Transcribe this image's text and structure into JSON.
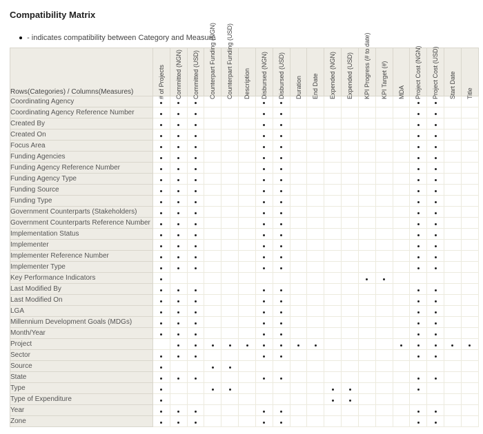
{
  "page_title": "Compatibility Matrix",
  "legend_text": "- indicates compatibility between Category and Measure",
  "corner_label": "Rows(Categories) / Columns(Measures)",
  "columns": [
    "# of Projects",
    "Committed (NGN)",
    "Committed (USD)",
    "Counterpart Funding (NGN)",
    "Counterpart Funding (USD)",
    "Description",
    "Disbursed (NGN)",
    "Disbursed (USD)",
    "Duration",
    "End Date",
    "Expended (NGN)",
    "Expended (USD)",
    "KPI Progress (# to date)",
    "KPI Target (#)",
    "MDA",
    "Project Cost (NGN)",
    "Project Cost (USD)",
    "Start Date",
    "Title"
  ],
  "rows": [
    "Coordinating Agency",
    "Coordinating Agency Reference Number",
    "Created By",
    "Created On",
    "Focus Area",
    "Funding Agencies",
    "Funding Agency Reference Number",
    "Funding Agency Type",
    "Funding Source",
    "Funding Type",
    "Government Counterparts (Stakeholders)",
    "Government Counterparts Reference Number",
    "Implementation Status",
    "Implementer",
    "Implementer Reference Number",
    "Implementer Type",
    "Key Performance Indicators",
    "Last Modified By",
    "Last Modified On",
    "LGA",
    "Millennium Development Goals (MDGs)",
    "Month/Year",
    "Project",
    "Sector",
    "Source",
    "State",
    "Type",
    "Type of Expenditure",
    "Year",
    "Zone"
  ],
  "matrix_comment": "1 = dot present, 0 = empty. Columns order matches 'columns' array.",
  "matrix": [
    [
      1,
      1,
      1,
      0,
      0,
      0,
      1,
      1,
      0,
      0,
      0,
      0,
      0,
      0,
      0,
      1,
      1,
      0,
      0
    ],
    [
      1,
      1,
      1,
      0,
      0,
      0,
      1,
      1,
      0,
      0,
      0,
      0,
      0,
      0,
      0,
      1,
      1,
      0,
      0
    ],
    [
      1,
      1,
      1,
      0,
      0,
      0,
      1,
      1,
      0,
      0,
      0,
      0,
      0,
      0,
      0,
      1,
      1,
      0,
      0
    ],
    [
      1,
      1,
      1,
      0,
      0,
      0,
      1,
      1,
      0,
      0,
      0,
      0,
      0,
      0,
      0,
      1,
      1,
      0,
      0
    ],
    [
      1,
      1,
      1,
      0,
      0,
      0,
      1,
      1,
      0,
      0,
      0,
      0,
      0,
      0,
      0,
      1,
      1,
      0,
      0
    ],
    [
      1,
      1,
      1,
      0,
      0,
      0,
      1,
      1,
      0,
      0,
      0,
      0,
      0,
      0,
      0,
      1,
      1,
      0,
      0
    ],
    [
      1,
      1,
      1,
      0,
      0,
      0,
      1,
      1,
      0,
      0,
      0,
      0,
      0,
      0,
      0,
      1,
      1,
      0,
      0
    ],
    [
      1,
      1,
      1,
      0,
      0,
      0,
      1,
      1,
      0,
      0,
      0,
      0,
      0,
      0,
      0,
      1,
      1,
      0,
      0
    ],
    [
      1,
      1,
      1,
      0,
      0,
      0,
      1,
      1,
      0,
      0,
      0,
      0,
      0,
      0,
      0,
      1,
      1,
      0,
      0
    ],
    [
      1,
      1,
      1,
      0,
      0,
      0,
      1,
      1,
      0,
      0,
      0,
      0,
      0,
      0,
      0,
      1,
      1,
      0,
      0
    ],
    [
      1,
      1,
      1,
      0,
      0,
      0,
      1,
      1,
      0,
      0,
      0,
      0,
      0,
      0,
      0,
      1,
      1,
      0,
      0
    ],
    [
      1,
      1,
      1,
      0,
      0,
      0,
      1,
      1,
      0,
      0,
      0,
      0,
      0,
      0,
      0,
      1,
      1,
      0,
      0
    ],
    [
      1,
      1,
      1,
      0,
      0,
      0,
      1,
      1,
      0,
      0,
      0,
      0,
      0,
      0,
      0,
      1,
      1,
      0,
      0
    ],
    [
      1,
      1,
      1,
      0,
      0,
      0,
      1,
      1,
      0,
      0,
      0,
      0,
      0,
      0,
      0,
      1,
      1,
      0,
      0
    ],
    [
      1,
      1,
      1,
      0,
      0,
      0,
      1,
      1,
      0,
      0,
      0,
      0,
      0,
      0,
      0,
      1,
      1,
      0,
      0
    ],
    [
      1,
      1,
      1,
      0,
      0,
      0,
      1,
      1,
      0,
      0,
      0,
      0,
      0,
      0,
      0,
      1,
      1,
      0,
      0
    ],
    [
      1,
      0,
      0,
      0,
      0,
      0,
      0,
      0,
      0,
      0,
      0,
      0,
      1,
      1,
      0,
      0,
      0,
      0,
      0
    ],
    [
      1,
      1,
      1,
      0,
      0,
      0,
      1,
      1,
      0,
      0,
      0,
      0,
      0,
      0,
      0,
      1,
      1,
      0,
      0
    ],
    [
      1,
      1,
      1,
      0,
      0,
      0,
      1,
      1,
      0,
      0,
      0,
      0,
      0,
      0,
      0,
      1,
      1,
      0,
      0
    ],
    [
      1,
      1,
      1,
      0,
      0,
      0,
      1,
      1,
      0,
      0,
      0,
      0,
      0,
      0,
      0,
      1,
      1,
      0,
      0
    ],
    [
      1,
      1,
      1,
      0,
      0,
      0,
      1,
      1,
      0,
      0,
      0,
      0,
      0,
      0,
      0,
      1,
      1,
      0,
      0
    ],
    [
      1,
      1,
      1,
      0,
      0,
      0,
      1,
      1,
      0,
      0,
      0,
      0,
      0,
      0,
      0,
      1,
      1,
      0,
      0
    ],
    [
      0,
      1,
      1,
      1,
      1,
      1,
      1,
      1,
      1,
      1,
      0,
      0,
      0,
      0,
      1,
      1,
      1,
      1,
      1
    ],
    [
      1,
      1,
      1,
      0,
      0,
      0,
      1,
      1,
      0,
      0,
      0,
      0,
      0,
      0,
      0,
      1,
      1,
      0,
      0
    ],
    [
      1,
      0,
      0,
      1,
      1,
      0,
      0,
      0,
      0,
      0,
      0,
      0,
      0,
      0,
      0,
      0,
      0,
      0,
      0
    ],
    [
      1,
      1,
      1,
      0,
      0,
      0,
      1,
      1,
      0,
      0,
      0,
      0,
      0,
      0,
      0,
      1,
      1,
      0,
      0
    ],
    [
      1,
      0,
      0,
      1,
      1,
      0,
      0,
      0,
      0,
      0,
      1,
      1,
      0,
      0,
      0,
      1,
      0,
      0,
      0
    ],
    [
      1,
      0,
      0,
      0,
      0,
      0,
      0,
      0,
      0,
      0,
      1,
      1,
      0,
      0,
      0,
      0,
      0,
      0,
      0
    ],
    [
      1,
      1,
      1,
      0,
      0,
      0,
      1,
      1,
      0,
      0,
      0,
      0,
      0,
      0,
      0,
      1,
      1,
      0,
      0
    ],
    [
      1,
      1,
      1,
      0,
      0,
      0,
      1,
      1,
      0,
      0,
      0,
      0,
      0,
      0,
      0,
      1,
      1,
      0,
      0
    ]
  ]
}
